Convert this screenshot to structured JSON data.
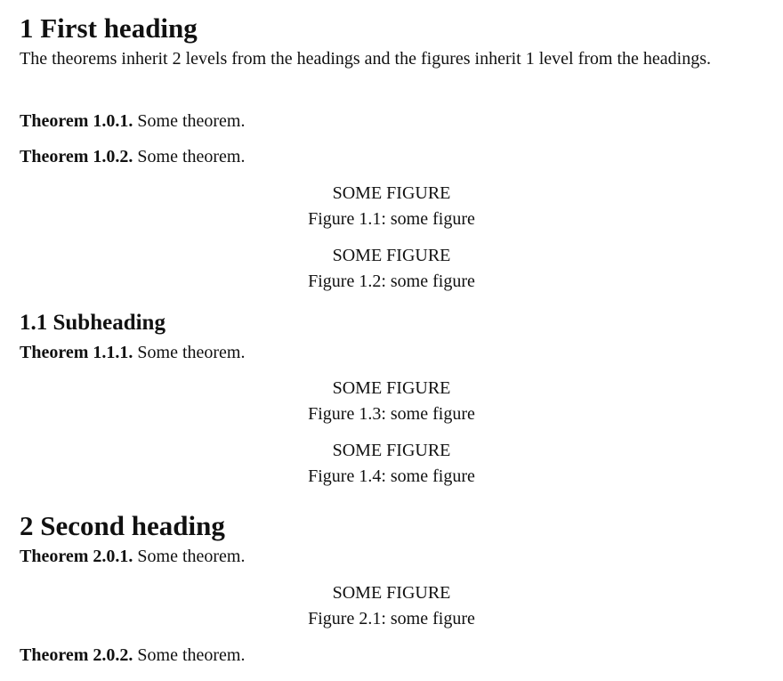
{
  "sections": {
    "s1": {
      "number": "1",
      "title": "First heading",
      "intro": "The theorems inherit 2 levels from the headings and the figures inherit 1 level from the headings."
    },
    "s1_1": {
      "number": "1.1",
      "title": "Subheading"
    },
    "s2": {
      "number": "2",
      "title": "Second heading"
    }
  },
  "theorems": {
    "t101": {
      "label": "Theorem 1.0.1.",
      "text": "Some theorem."
    },
    "t102": {
      "label": "Theorem 1.0.2.",
      "text": "Some theorem."
    },
    "t111": {
      "label": "Theorem 1.1.1.",
      "text": "Some theorem."
    },
    "t201": {
      "label": "Theorem 2.0.1.",
      "text": "Some theorem."
    },
    "t202": {
      "label": "Theorem 2.0.2.",
      "text": "Some theorem."
    }
  },
  "figures": {
    "f11": {
      "body": "SOME FIGURE",
      "caption": "Figure 1.1: some figure"
    },
    "f12": {
      "body": "SOME FIGURE",
      "caption": "Figure 1.2: some figure"
    },
    "f13": {
      "body": "SOME FIGURE",
      "caption": "Figure 1.3: some figure"
    },
    "f14": {
      "body": "SOME FIGURE",
      "caption": "Figure 1.4: some figure"
    },
    "f21": {
      "body": "SOME FIGURE",
      "caption": "Figure 2.1: some figure"
    }
  }
}
